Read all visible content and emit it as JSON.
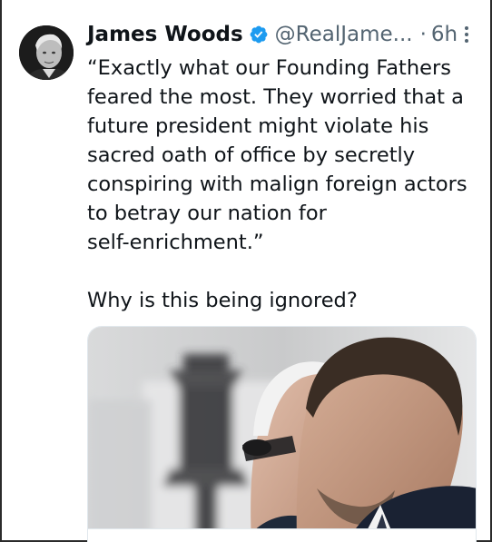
{
  "tweet": {
    "author": {
      "display_name": "James Woods",
      "handle": "@RealJame...",
      "verified": true
    },
    "separator": "·",
    "time": "6h",
    "text_lines": [
      "“Exactly what our Founding Fathers",
      "feared the most. They worried that a",
      "future president might violate his",
      "sacred oath of office by secretly",
      "conspiring with malign foreign actors",
      "to betray our nation for",
      "self-enrichment.”"
    ],
    "text_followup": "Why is this being ignored?",
    "media": {
      "description_icon": "photo-icon"
    }
  },
  "colors": {
    "verified_blue": "#1d9bf0",
    "secondary_text": "#536471",
    "primary_text": "#0f1419"
  }
}
